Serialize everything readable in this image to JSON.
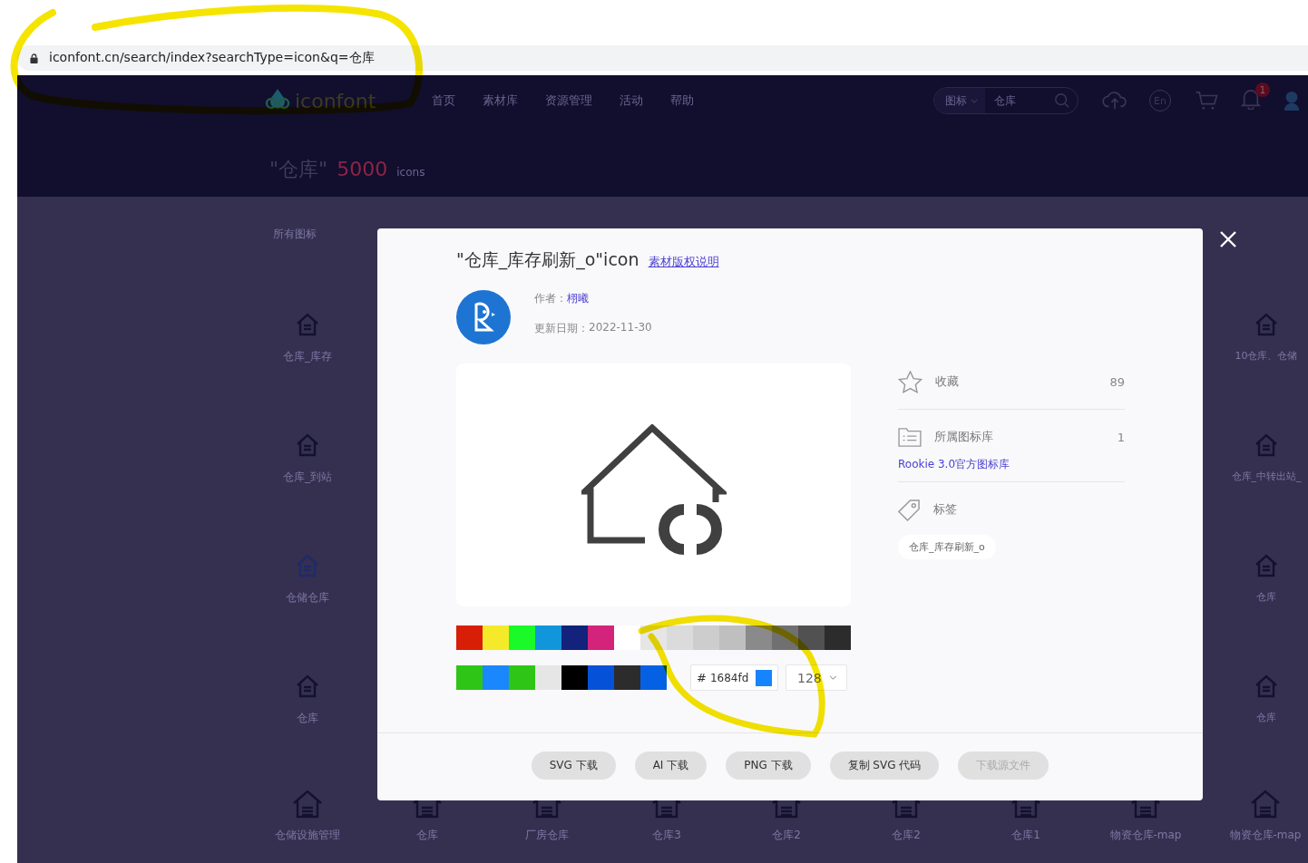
{
  "address_bar": {
    "url": "iconfont.cn/search/index?searchType=icon&q=仓库"
  },
  "header": {
    "logo": "iconfont",
    "nav": [
      "首页",
      "素材库",
      "资源管理",
      "活动",
      "帮助"
    ],
    "search": {
      "type": "图标",
      "value": "仓库"
    },
    "language": "En",
    "notification_count": "1",
    "query": "\"仓库\"",
    "count": "5000",
    "count_unit": "icons"
  },
  "filter": {
    "label": "所有图标"
  },
  "background_icons": {
    "left_column": [
      {
        "label": "仓库_库存",
        "color": "#141030"
      },
      {
        "label": "仓库_到站",
        "color": "#141030"
      },
      {
        "label": "仓储仓库",
        "color": "#1f2a6a"
      },
      {
        "label": "仓库",
        "color": "#141030"
      }
    ],
    "right_column": [
      {
        "label": "10仓库、仓储"
      },
      {
        "label": "仓库_中转出站_"
      },
      {
        "label": "仓库"
      },
      {
        "label": "仓库"
      }
    ],
    "bottom_row": [
      {
        "label": "仓储设施管理"
      },
      {
        "label": "仓库"
      },
      {
        "label": "厂房仓库"
      },
      {
        "label": "仓库3"
      },
      {
        "label": "仓库2"
      },
      {
        "label": "仓库2"
      },
      {
        "label": "仓库1"
      },
      {
        "label": "物资仓库-map"
      },
      {
        "label": "物资仓库-map"
      }
    ]
  },
  "dialog": {
    "title": "\"仓库_库存刷新_o\"icon",
    "copyright_link": "素材版权说明",
    "author_label": "作者：",
    "author": "栩曦",
    "date_label": "更新日期：",
    "date": "2022-11-30",
    "palette_top": [
      {
        "color": "#d81e06"
      },
      {
        "color": "#f4ea2a"
      },
      {
        "color": "#1afa29"
      },
      {
        "color": "#1296db"
      },
      {
        "color": "#13227a"
      },
      {
        "color": "#d4237a"
      },
      {
        "color": "#ffffff"
      },
      {
        "color": "#e6e6e6"
      },
      {
        "color": "#dbdbdb"
      },
      {
        "color": "#cdcdcd"
      },
      {
        "color": "#bfbfbf"
      },
      {
        "color": "#8a8a8a"
      },
      {
        "color": "#707070"
      },
      {
        "color": "#515151"
      },
      {
        "color": "#2c2c2c"
      }
    ],
    "palette_bottom": [
      {
        "color": "#2ec516"
      },
      {
        "color": "#1b87fe"
      },
      {
        "color": "#2ec516"
      },
      {
        "color": "#e6e6e6"
      },
      {
        "color": "#000000"
      },
      {
        "color": "#0552d8"
      },
      {
        "color": "#2c2c2c"
      },
      {
        "color": "#0561e4"
      }
    ],
    "hex_prefix": "#",
    "hex_value": "1684fd",
    "size": "128",
    "stats": [
      {
        "kind": "favorite",
        "label": "收藏",
        "count": "89"
      },
      {
        "kind": "library",
        "label": "所属图标库",
        "count": "1",
        "link": "Rookie 3.0官方图标库"
      },
      {
        "kind": "tags",
        "label": "标签",
        "tags": [
          "仓库_库存刷新_o"
        ]
      }
    ],
    "buttons": [
      {
        "label": "SVG 下载",
        "disabled": false
      },
      {
        "label": "AI 下载",
        "disabled": false
      },
      {
        "label": "PNG 下载",
        "disabled": false
      },
      {
        "label": "复制 SVG 代码",
        "disabled": false
      },
      {
        "label": "下载源文件",
        "disabled": true
      }
    ]
  }
}
